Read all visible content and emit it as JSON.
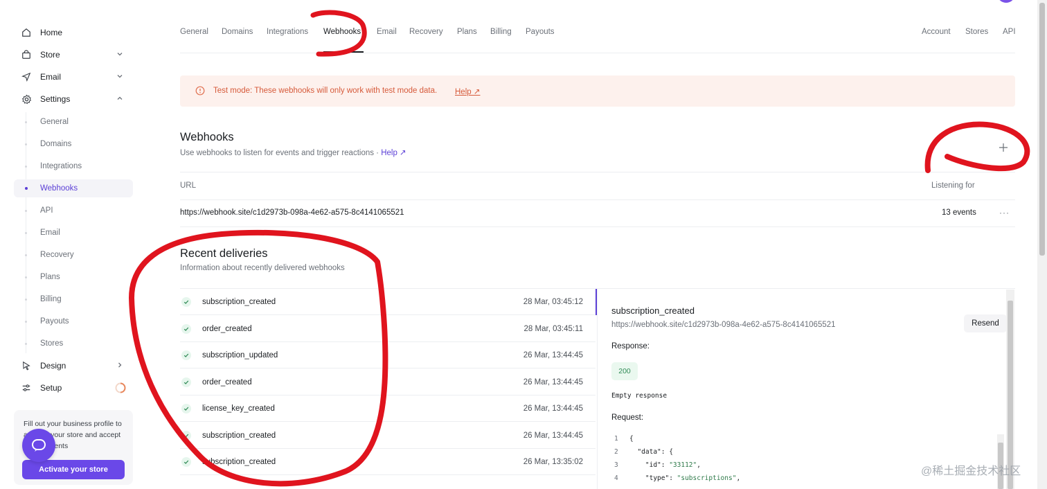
{
  "sidebar": {
    "nav": [
      {
        "label": "Home",
        "icon": "home-icon"
      },
      {
        "label": "Store",
        "icon": "bag-icon"
      },
      {
        "label": "Email",
        "icon": "send-icon"
      },
      {
        "label": "Settings",
        "icon": "gear-icon"
      }
    ],
    "settings_items": [
      "General",
      "Domains",
      "Integrations",
      "Webhooks",
      "API",
      "Email",
      "Recovery",
      "Plans",
      "Billing",
      "Payouts",
      "Stores"
    ],
    "active_settings_item": "Webhooks",
    "nav_bottom": [
      {
        "label": "Design",
        "icon": "cursor-icon"
      },
      {
        "label": "Setup",
        "icon": "sliders-icon"
      }
    ],
    "promo": {
      "text": "Fill out your business profile to activate your store and accept live payments",
      "button": "Activate your store"
    }
  },
  "tabs": {
    "left": [
      "General",
      "Domains",
      "Integrations",
      "Webhooks",
      "Email",
      "Recovery",
      "Plans",
      "Billing",
      "Payouts"
    ],
    "right": [
      "Account",
      "Stores",
      "API"
    ],
    "active": "Webhooks"
  },
  "alert": {
    "text": "Test mode: These webhooks will only work with test mode data.",
    "link": "Help ↗"
  },
  "webhooks": {
    "title": "Webhooks",
    "subtitle": "Use webhooks to listen for events and trigger reactions · ",
    "help": "Help ↗",
    "columns": {
      "url": "URL",
      "listening": "Listening for"
    },
    "rows": [
      {
        "url": "https://webhook.site/c1d2973b-098a-4e62-a575-8c4141065521",
        "events": "13 events",
        "menu": "···"
      }
    ]
  },
  "deliveries": {
    "title": "Recent deliveries",
    "subtitle": "Information about recently delivered webhooks",
    "items": [
      {
        "event": "subscription_created",
        "time": "28 Mar, 03:45:12"
      },
      {
        "event": "order_created",
        "time": "28 Mar, 03:45:11"
      },
      {
        "event": "subscription_updated",
        "time": "26 Mar, 13:44:45"
      },
      {
        "event": "order_created",
        "time": "26 Mar, 13:44:45"
      },
      {
        "event": "license_key_created",
        "time": "26 Mar, 13:44:45"
      },
      {
        "event": "subscription_created",
        "time": "26 Mar, 13:44:45"
      },
      {
        "event": "subscription_created",
        "time": "26 Mar, 13:35:02"
      }
    ]
  },
  "detail": {
    "title": "subscription_created",
    "url": "https://webhook.site/c1d2973b-098a-4e62-a575-8c4141065521",
    "resend": "Resend",
    "response_label": "Response:",
    "status_code": "200",
    "empty_response": "Empty response",
    "request_label": "Request:",
    "code": [
      {
        "n": "1",
        "pre": "{",
        "str": "",
        "post": ""
      },
      {
        "n": "2",
        "pre": "  \"data\": {",
        "str": "",
        "post": ""
      },
      {
        "n": "3",
        "pre": "    \"id\": ",
        "str": "\"33112\"",
        "post": ","
      },
      {
        "n": "4",
        "pre": "    \"type\": ",
        "str": "\"subscriptions\"",
        "post": ","
      }
    ]
  },
  "watermark": "@稀土掘金技术社区",
  "colors": {
    "accent": "#6a48e8",
    "alert_bg": "#fdf1ed",
    "alert_text": "#d65a3a",
    "success": "#2f8a55",
    "annotation": "#e0141e"
  }
}
